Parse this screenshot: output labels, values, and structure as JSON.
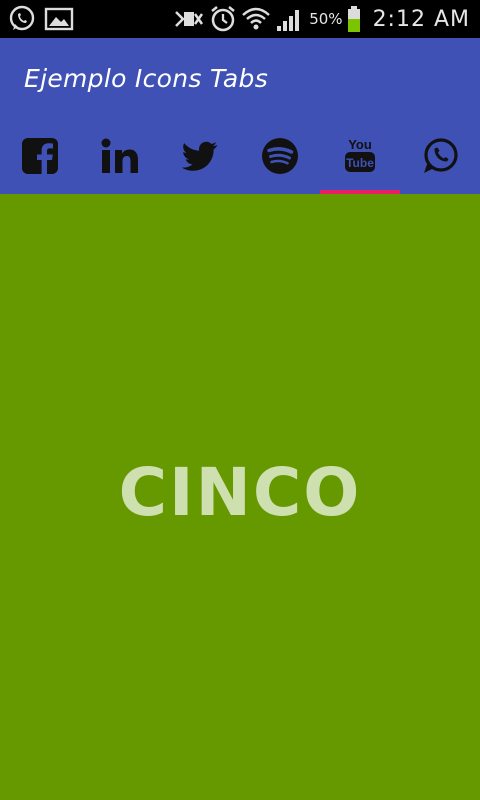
{
  "status_bar": {
    "battery_percent": "50%",
    "time": "2:12 AM",
    "icons": [
      "whatsapp-icon",
      "gallery-icon",
      "mute-icon",
      "alarm-icon",
      "wifi-icon",
      "signal-icon",
      "battery-icon"
    ]
  },
  "app_bar": {
    "title": "Ejemplo Icons Tabs",
    "color": "#3f51b5"
  },
  "tabs": [
    {
      "icon": "facebook-icon",
      "selected": false
    },
    {
      "icon": "linkedin-icon",
      "selected": false
    },
    {
      "icon": "twitter-icon",
      "selected": false
    },
    {
      "icon": "spotify-icon",
      "selected": false
    },
    {
      "icon": "youtube-icon",
      "selected": true
    },
    {
      "icon": "whatsapp-icon",
      "selected": false
    }
  ],
  "tab_indicator_color": "#e91e63",
  "content": {
    "text": "CINCO",
    "background": "#669900",
    "text_color": "#cfe0b0"
  }
}
